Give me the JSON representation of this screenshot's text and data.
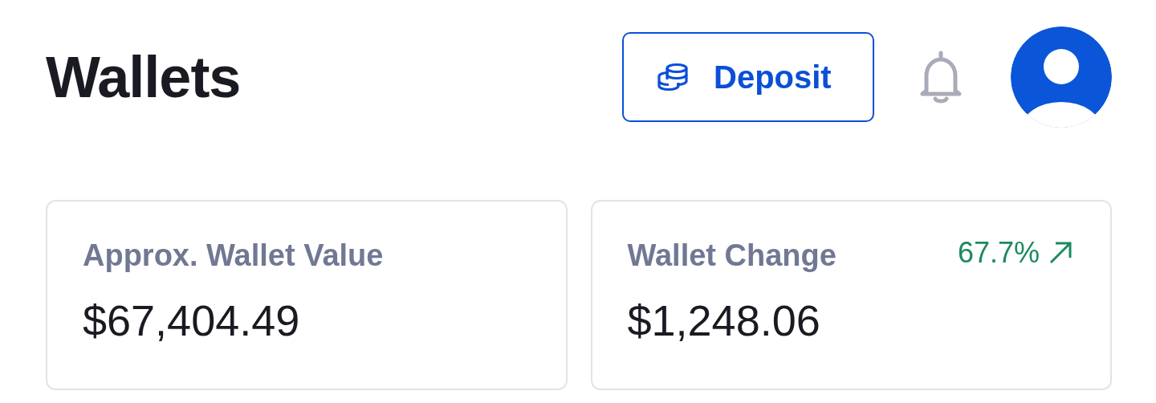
{
  "header": {
    "title": "Wallets",
    "deposit_button": {
      "label": "Deposit"
    }
  },
  "cards": [
    {
      "label": "Approx. Wallet Value",
      "value": "$67,404.49"
    },
    {
      "label": "Wallet Change",
      "value": "$1,248.06",
      "change": {
        "text": "67.7%",
        "rising": true
      }
    }
  ]
}
